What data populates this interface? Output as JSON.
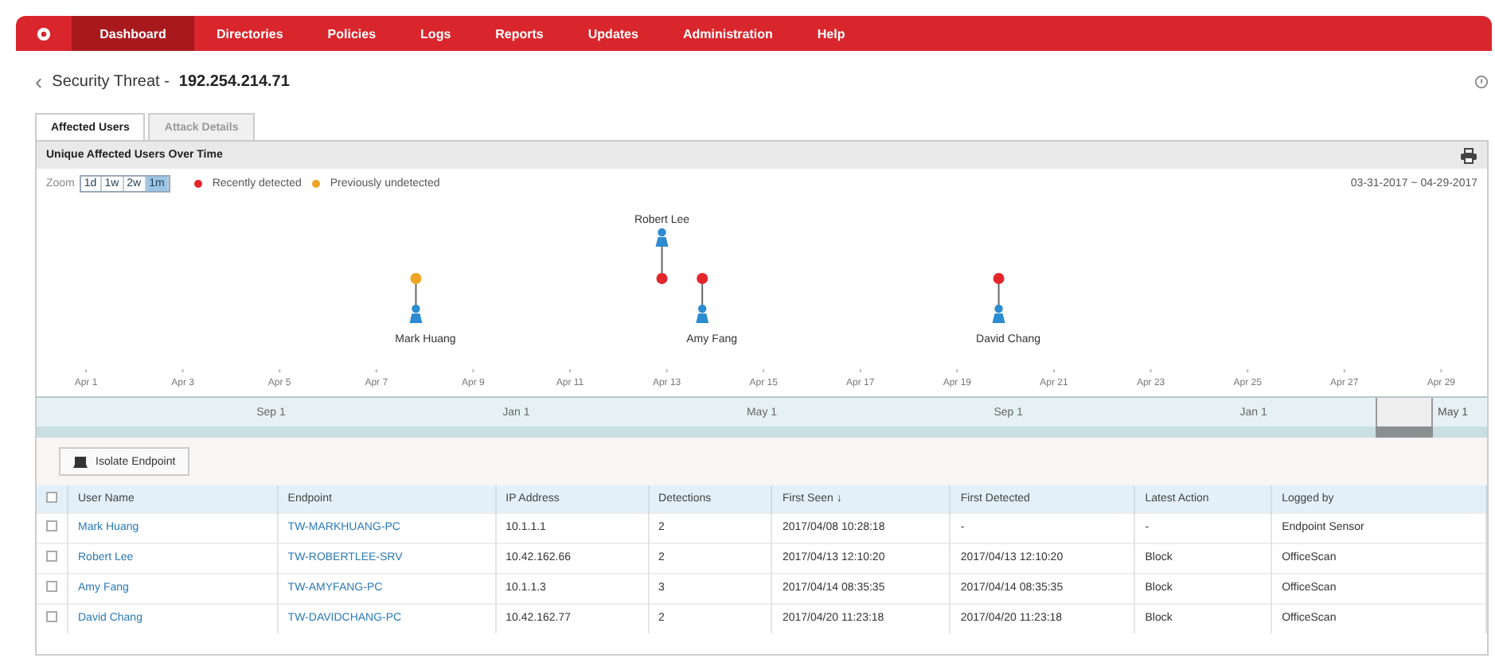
{
  "nav": {
    "items": [
      {
        "label": "Dashboard",
        "selected": true
      },
      {
        "label": "Directories",
        "selected": false
      },
      {
        "label": "Policies",
        "selected": false
      },
      {
        "label": "Logs",
        "selected": false
      },
      {
        "label": "Reports",
        "selected": false
      },
      {
        "label": "Updates",
        "selected": false
      },
      {
        "label": "Administration",
        "selected": false
      },
      {
        "label": "Help",
        "selected": false
      }
    ]
  },
  "header": {
    "back": "‹",
    "title": "Security Threat -",
    "ip": "192.254.214.71"
  },
  "tabs": [
    {
      "label": "Affected Users",
      "selected": true,
      "disabled": false
    },
    {
      "label": "Attack Details",
      "selected": false,
      "disabled": true
    }
  ],
  "panel": {
    "title": "Unique Affected Users Over Time",
    "zoom_label": "Zoom",
    "zoom": [
      {
        "label": "1d",
        "selected": false
      },
      {
        "label": "1w",
        "selected": false
      },
      {
        "label": "2w",
        "selected": false
      },
      {
        "label": "1m",
        "selected": true
      }
    ],
    "date_range": "03-31-2017 ~ 04-29-2017",
    "legend": [
      {
        "label": "Recently detected",
        "kind": "recent",
        "color": "#e3262b"
      },
      {
        "label": "Previously undetected",
        "kind": "previous",
        "color": "#f0a324"
      }
    ],
    "timeline": {
      "axis_labels": [
        "Apr 1",
        "Apr 3",
        "Apr 5",
        "Apr 7",
        "Apr 9",
        "Apr 11",
        "Apr 13",
        "Apr 15",
        "Apr 17",
        "Apr 19",
        "Apr 21",
        "Apr 23",
        "Apr 25",
        "Apr 27",
        "Apr 29"
      ],
      "markers": [
        {
          "name": "Mark Huang",
          "kind": "previous",
          "label_above": false
        },
        {
          "name": "Robert Lee",
          "kind": "recent",
          "label_above": true
        },
        {
          "name": "Amy Fang",
          "kind": "recent",
          "label_above": false
        },
        {
          "name": "David Chang",
          "kind": "recent",
          "label_above": false
        }
      ]
    },
    "navigator": {
      "labels": [
        "Sep 1",
        "Jan 1",
        "May 1",
        "Sep 1",
        "Jan 1"
      ],
      "window_label": "May 1"
    }
  },
  "action_button": "Isolate Endpoint",
  "table": {
    "all_checked": false,
    "sort_mark": "↓",
    "columns": [
      {
        "label": "User Name",
        "kind": "link",
        "sorted": false
      },
      {
        "label": "Endpoint",
        "kind": "link",
        "sorted": false
      },
      {
        "label": "IP Address",
        "kind": "text",
        "sorted": false
      },
      {
        "label": "Detections",
        "kind": "text",
        "sorted": false
      },
      {
        "label": "First Seen",
        "kind": "text",
        "sorted": true
      },
      {
        "label": "First Detected",
        "kind": "text",
        "sorted": false
      },
      {
        "label": "Latest Action",
        "kind": "text",
        "sorted": false
      },
      {
        "label": "Logged by",
        "kind": "text",
        "sorted": false
      }
    ],
    "rows": [
      {
        "checked": false,
        "cells": [
          "Mark Huang",
          "TW-MARKHUANG-PC",
          "10.1.1.1",
          "2",
          "2017/04/08 10:28:18",
          "-",
          "-",
          "Endpoint Sensor"
        ]
      },
      {
        "checked": false,
        "cells": [
          "Robert Lee",
          "TW-ROBERTLEE-SRV",
          "10.42.162.66",
          "2",
          "2017/04/13 12:10:20",
          "2017/04/13 12:10:20",
          "Block",
          "OfficeScan"
        ]
      },
      {
        "checked": false,
        "cells": [
          "Amy Fang",
          "TW-AMYFANG-PC",
          "10.1.1.3",
          "3",
          "2017/04/14 08:35:35",
          "2017/04/14 08:35:35",
          "Block",
          "OfficeScan"
        ]
      },
      {
        "checked": false,
        "cells": [
          "David Chang",
          "TW-DAVIDCHANG-PC",
          "10.42.162.77",
          "2",
          "2017/04/20 11:23:18",
          "2017/04/20 11:23:18",
          "Block",
          "OfficeScan"
        ]
      }
    ]
  }
}
